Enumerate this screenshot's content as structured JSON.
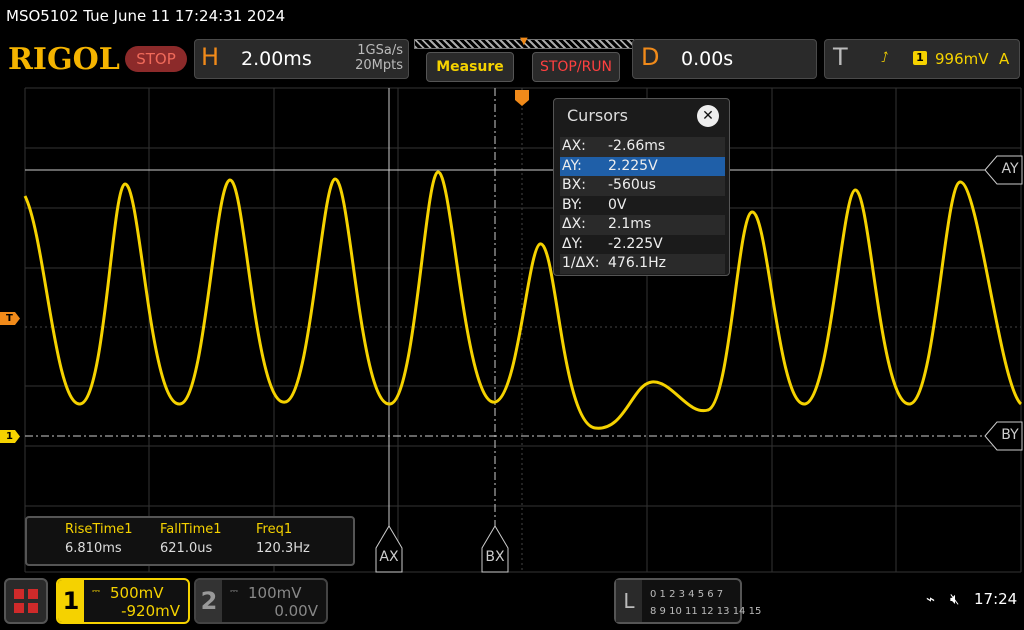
{
  "status": {
    "text": "MSO5102  Tue June 11 17:24:31 2024"
  },
  "brand": "RIGOL",
  "run_state": "STOP",
  "horizontal": {
    "letter": "H",
    "timebase": "2.00ms",
    "sample_rate": "1GSa/s",
    "memory_depth": "20Mpts"
  },
  "buttons": {
    "measure": "Measure",
    "stop_run": "STOP/RUN"
  },
  "delay": {
    "letter": "D",
    "value": "0.00s"
  },
  "trigger": {
    "letter": "T",
    "edge_icon": "rising-edge-icon",
    "source": "1",
    "level": "996mV",
    "mode": "A"
  },
  "markers": {
    "trigger_level": "T",
    "ch1": "1"
  },
  "cursors": {
    "title": "Cursors",
    "rows": [
      {
        "key": "AX:",
        "value": "-2.66ms"
      },
      {
        "key": "AY:",
        "value": "2.225V"
      },
      {
        "key": "BX:",
        "value": "-560us"
      },
      {
        "key": "BY:",
        "value": "0V"
      },
      {
        "key": "ΔX:",
        "value": "2.1ms"
      },
      {
        "key": "ΔY:",
        "value": "-2.225V"
      },
      {
        "key": "1/ΔX:",
        "value": "476.1Hz"
      }
    ],
    "selected_row": 1,
    "tags": {
      "ay": "AY",
      "by": "BY",
      "ax": "AX",
      "bx": "BX"
    }
  },
  "measurements": [
    {
      "name": "RiseTime1",
      "value": "6.810ms"
    },
    {
      "name": "FallTime1",
      "value": "621.0us"
    },
    {
      "name": "Freq1",
      "value": "120.3Hz"
    }
  ],
  "channel1": {
    "number": "1",
    "scale": "500mV",
    "offset": "-920mV"
  },
  "channel2": {
    "number": "2",
    "scale": "100mV",
    "offset": "0.00V"
  },
  "logic": {
    "letter": "L",
    "row1": "0 1 2 3  4 5 6 7",
    "row2": "8 9 10 11 12 13 14 15"
  },
  "system": {
    "time": "17:24",
    "usb_icon": "usb-icon",
    "sound_icon": "speaker-muted-icon"
  },
  "colors": {
    "ch1": "#f5d200",
    "accent": "#f08a1a",
    "stop": "#ff4040",
    "selected": "#1f5fa8"
  }
}
